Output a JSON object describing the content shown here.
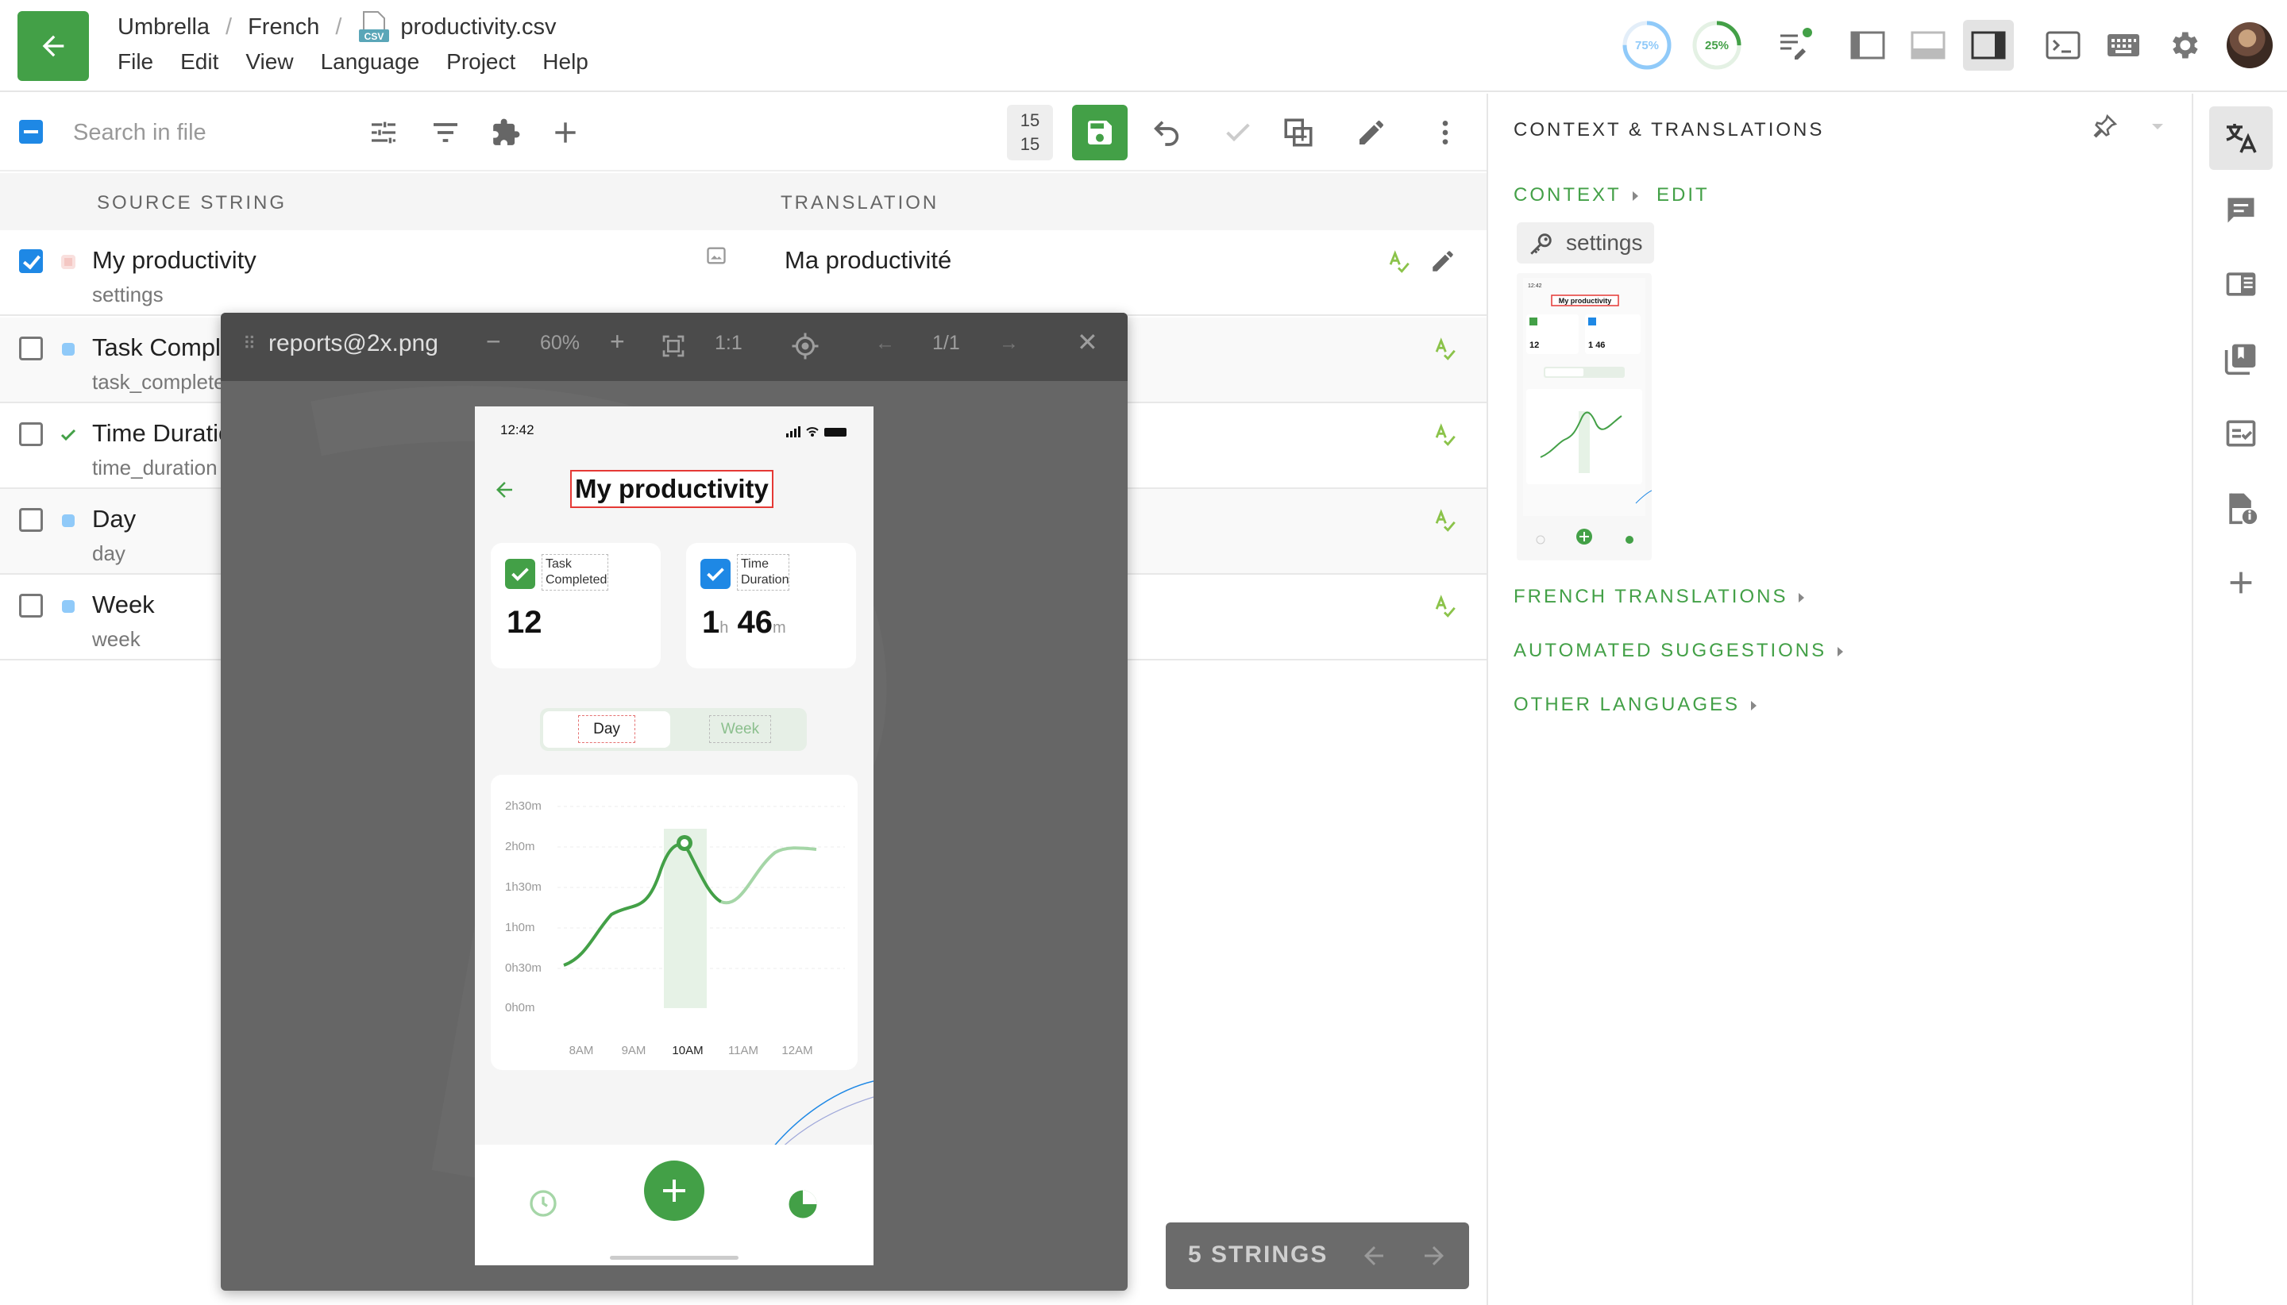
{
  "header": {
    "breadcrumb": {
      "project": "Umbrella",
      "language": "French",
      "file": "productivity.csv",
      "file_type": "CSV"
    },
    "menus": [
      "File",
      "Edit",
      "View",
      "Language",
      "Project",
      "Help"
    ],
    "progress": [
      {
        "label": "75%",
        "value": 0.75,
        "color": "#90caf9"
      },
      {
        "label": "25%",
        "value": 0.25,
        "color": "#43a047"
      }
    ]
  },
  "toolbar": {
    "search_placeholder": "Search in file",
    "counter_top": "15",
    "counter_bottom": "15"
  },
  "columns": {
    "source": "SOURCE STRING",
    "translation": "TRANSLATION"
  },
  "strings": [
    {
      "source": "My productivity",
      "key": "settings",
      "translation": "Ma productivité",
      "checked": true,
      "status_color": "#e57373"
    },
    {
      "source": "Task Completed",
      "key": "task_completed",
      "translation": "",
      "checked": false,
      "status_color": "#90caf9"
    },
    {
      "source": "Time Duration",
      "key": "time_duration",
      "translation": "",
      "checked": false,
      "status_color": "#43a047"
    },
    {
      "source": "Day",
      "key": "day",
      "translation": "",
      "checked": false,
      "status_color": "#90caf9"
    },
    {
      "source": "Week",
      "key": "week",
      "translation": "",
      "checked": false,
      "status_color": "#90caf9"
    }
  ],
  "viewer": {
    "title": "reports@2x.png",
    "zoom": "60%",
    "ratio": "1:1",
    "pages": "1/1",
    "phone": {
      "time": "12:42",
      "title": "My productivity",
      "card1_label": "Task Completed",
      "card1_value": "12",
      "card2_label": "Time Duration",
      "card2_hours": "1",
      "card2_h": "h",
      "card2_minutes": "46",
      "card2_m": "m",
      "tab_day": "Day",
      "tab_week": "Week",
      "chart": {
        "y_ticks": [
          "2h30m",
          "2h0m",
          "1h30m",
          "1h0m",
          "0h30m",
          "0h0m"
        ],
        "x_ticks": [
          "8AM",
          "9AM",
          "10AM",
          "11AM",
          "12AM"
        ]
      }
    }
  },
  "strings_counter": "5 STRINGS",
  "context_panel": {
    "title": "CONTEXT & TRANSLATIONS",
    "context_label": "CONTEXT",
    "edit_label": "EDIT",
    "key": "settings",
    "sections": [
      "FRENCH TRANSLATIONS",
      "AUTOMATED SUGGESTIONS",
      "OTHER LANGUAGES"
    ],
    "thumb_title": "My productivity"
  },
  "colors": {
    "accent": "#43a047",
    "blue": "#1e88e5",
    "viewer_bg": "#666666"
  }
}
